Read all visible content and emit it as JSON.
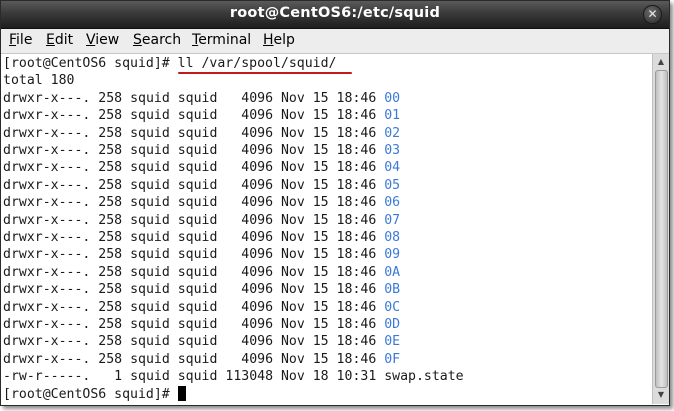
{
  "window": {
    "title": "root@CentOS6:/etc/squid",
    "close_glyph": "✕"
  },
  "menubar": {
    "items": [
      {
        "mnemonic": "F",
        "rest": "ile"
      },
      {
        "mnemonic": "E",
        "rest": "dit"
      },
      {
        "mnemonic": "V",
        "rest": "iew"
      },
      {
        "mnemonic": "S",
        "rest": "earch"
      },
      {
        "mnemonic": "T",
        "rest": "erminal"
      },
      {
        "mnemonic": "H",
        "rest": "elp"
      }
    ]
  },
  "terminal": {
    "prompt": "[root@CentOS6 squid]# ",
    "command": "ll /var/spool/squid/",
    "total": "total 180",
    "rows": [
      {
        "perms": "drwxr-x---.",
        "links": "258",
        "owner": "squid",
        "group": "squid",
        "size": "4096",
        "date": "Nov 15 18:46",
        "name": "00"
      },
      {
        "perms": "drwxr-x---.",
        "links": "258",
        "owner": "squid",
        "group": "squid",
        "size": "4096",
        "date": "Nov 15 18:46",
        "name": "01"
      },
      {
        "perms": "drwxr-x---.",
        "links": "258",
        "owner": "squid",
        "group": "squid",
        "size": "4096",
        "date": "Nov 15 18:46",
        "name": "02"
      },
      {
        "perms": "drwxr-x---.",
        "links": "258",
        "owner": "squid",
        "group": "squid",
        "size": "4096",
        "date": "Nov 15 18:46",
        "name": "03"
      },
      {
        "perms": "drwxr-x---.",
        "links": "258",
        "owner": "squid",
        "group": "squid",
        "size": "4096",
        "date": "Nov 15 18:46",
        "name": "04"
      },
      {
        "perms": "drwxr-x---.",
        "links": "258",
        "owner": "squid",
        "group": "squid",
        "size": "4096",
        "date": "Nov 15 18:46",
        "name": "05"
      },
      {
        "perms": "drwxr-x---.",
        "links": "258",
        "owner": "squid",
        "group": "squid",
        "size": "4096",
        "date": "Nov 15 18:46",
        "name": "06"
      },
      {
        "perms": "drwxr-x---.",
        "links": "258",
        "owner": "squid",
        "group": "squid",
        "size": "4096",
        "date": "Nov 15 18:46",
        "name": "07"
      },
      {
        "perms": "drwxr-x---.",
        "links": "258",
        "owner": "squid",
        "group": "squid",
        "size": "4096",
        "date": "Nov 15 18:46",
        "name": "08"
      },
      {
        "perms": "drwxr-x---.",
        "links": "258",
        "owner": "squid",
        "group": "squid",
        "size": "4096",
        "date": "Nov 15 18:46",
        "name": "09"
      },
      {
        "perms": "drwxr-x---.",
        "links": "258",
        "owner": "squid",
        "group": "squid",
        "size": "4096",
        "date": "Nov 15 18:46",
        "name": "0A"
      },
      {
        "perms": "drwxr-x---.",
        "links": "258",
        "owner": "squid",
        "group": "squid",
        "size": "4096",
        "date": "Nov 15 18:46",
        "name": "0B"
      },
      {
        "perms": "drwxr-x---.",
        "links": "258",
        "owner": "squid",
        "group": "squid",
        "size": "4096",
        "date": "Nov 15 18:46",
        "name": "0C"
      },
      {
        "perms": "drwxr-x---.",
        "links": "258",
        "owner": "squid",
        "group": "squid",
        "size": "4096",
        "date": "Nov 15 18:46",
        "name": "0D"
      },
      {
        "perms": "drwxr-x---.",
        "links": "258",
        "owner": "squid",
        "group": "squid",
        "size": "4096",
        "date": "Nov 15 18:46",
        "name": "0E"
      },
      {
        "perms": "drwxr-x---.",
        "links": "258",
        "owner": "squid",
        "group": "squid",
        "size": "4096",
        "date": "Nov 15 18:46",
        "name": "0F"
      },
      {
        "perms": "-rw-r-----.",
        "links": "1",
        "owner": "squid",
        "group": "squid",
        "size": "113048",
        "date": "Nov 18 10:31",
        "name": "swap.state"
      }
    ],
    "final_prompt": "[root@CentOS6 squid]# "
  },
  "colors": {
    "directory": "#3b7ad9",
    "annotation_underline": "#c21a1a",
    "titlebar": "#2e2e2e"
  },
  "scrollbar": {
    "up_glyph": "▲",
    "down_glyph": "▼"
  }
}
